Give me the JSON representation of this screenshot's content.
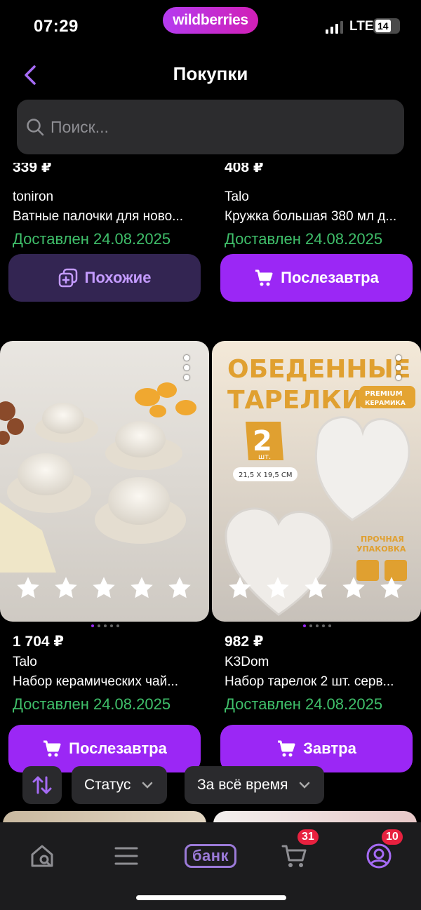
{
  "status_bar": {
    "time": "07:29",
    "brand": "wildberries",
    "network": "LTE",
    "battery": "14"
  },
  "header": {
    "title": "Покупки"
  },
  "search": {
    "placeholder": "Поиск..."
  },
  "products": [
    {
      "price": "339 ₽",
      "brand": "toniron",
      "name": "Ватные палочки для ново...",
      "delivery": "Доставлен 24.08.2025",
      "button": "Похожие",
      "button_style": "secondary"
    },
    {
      "price": "408 ₽",
      "brand": "Talo",
      "name": "Кружка большая 380 мл д...",
      "delivery": "Доставлен 24.08.2025",
      "button": "Послезавтра",
      "button_style": "primary"
    },
    {
      "price": "1 704 ₽",
      "brand": "Talo",
      "name": "Набор керамических чай...",
      "delivery": "Доставлен 24.08.2025",
      "button": "Послезавтра",
      "button_style": "primary",
      "rating_stars": 5,
      "image": "ceramic-tea-set"
    },
    {
      "price": "982 ₽",
      "brand": "K3Dom",
      "name": "Набор тарелок 2 шт. серв...",
      "delivery": "Доставлен 24.08.2025",
      "button": "Завтра",
      "button_style": "primary",
      "rating_stars": 5,
      "image": "heart-plates",
      "image_text": {
        "line1": "ОБЕДЕННЫЕ",
        "line2": "ТАРЕЛКИ",
        "premium": "PREMIUM",
        "premium_sub": "КЕРАМИКА",
        "count": "2",
        "count_unit": "шт.",
        "size": "21,5 X 19,5 СМ",
        "packing": "ПРОЧНАЯ",
        "packing_sub": "УПАКОВКА"
      }
    }
  ],
  "filters": {
    "status": "Статус",
    "period": "За всё время"
  },
  "bottom_nav": {
    "bank": "банк",
    "cart_badge": "31",
    "profile_badge": "10"
  },
  "colors": {
    "accent": "#9b27f5",
    "delivered": "#3fbf6a",
    "badge": "#e8213f",
    "background": "#000000"
  }
}
